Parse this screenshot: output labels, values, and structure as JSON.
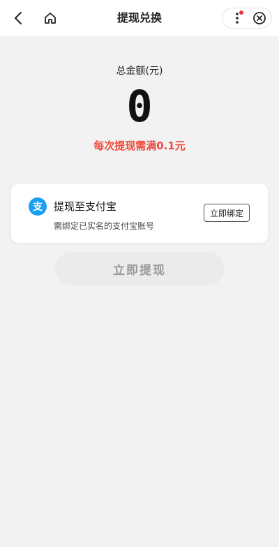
{
  "header": {
    "title": "提现兑换",
    "back_icon": "chevron-left-icon",
    "home_icon": "home-icon",
    "more_icon": "more-vertical-icon",
    "close_icon": "close-circle-icon"
  },
  "balance": {
    "label": "总金额(元)",
    "value": "0",
    "min_note": "每次提现需满0.1元"
  },
  "alipay_card": {
    "icon": "alipay-icon",
    "icon_glyph": "支",
    "title": "提现至支付宝",
    "subtitle": "需绑定已实名的支付宝账号",
    "bind_label": "立即绑定"
  },
  "withdraw_button": {
    "label": "立即提现"
  },
  "colors": {
    "background": "#f2f2f3",
    "accent_red": "#ee4a3d",
    "alipay_blue": "#1a9ff2",
    "notification_dot": "#ee3344"
  }
}
